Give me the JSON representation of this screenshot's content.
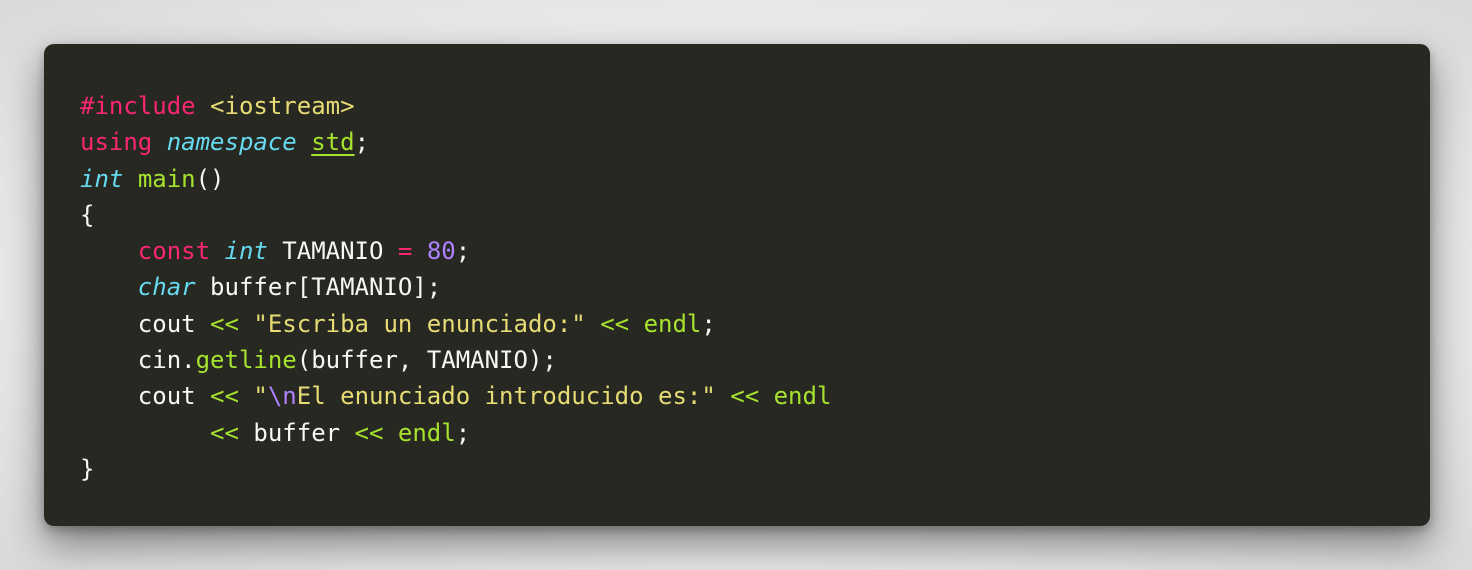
{
  "code": {
    "lines": [
      [
        {
          "t": "#include",
          "c": "kw"
        },
        {
          "t": " ",
          "c": "plain"
        },
        {
          "t": "<iostream>",
          "c": "str"
        }
      ],
      [
        {
          "t": "using",
          "c": "kw"
        },
        {
          "t": " ",
          "c": "plain"
        },
        {
          "t": "namespace",
          "c": "type"
        },
        {
          "t": " ",
          "c": "plain"
        },
        {
          "t": "std",
          "c": "ul"
        },
        {
          "t": ";",
          "c": "plain"
        }
      ],
      [
        {
          "t": "int",
          "c": "type"
        },
        {
          "t": " ",
          "c": "plain"
        },
        {
          "t": "main",
          "c": "fn"
        },
        {
          "t": "()",
          "c": "plain"
        }
      ],
      [
        {
          "t": "{",
          "c": "plain"
        }
      ],
      [
        {
          "t": "    ",
          "c": "plain"
        },
        {
          "t": "const",
          "c": "kw"
        },
        {
          "t": " ",
          "c": "plain"
        },
        {
          "t": "int",
          "c": "type"
        },
        {
          "t": " TAMANIO ",
          "c": "plain"
        },
        {
          "t": "=",
          "c": "op"
        },
        {
          "t": " ",
          "c": "plain"
        },
        {
          "t": "80",
          "c": "num"
        },
        {
          "t": ";",
          "c": "plain"
        }
      ],
      [
        {
          "t": "    ",
          "c": "plain"
        },
        {
          "t": "char",
          "c": "type"
        },
        {
          "t": " buffer[TAMANIO];",
          "c": "plain"
        }
      ],
      [
        {
          "t": "    cout ",
          "c": "plain"
        },
        {
          "t": "<<",
          "c": "stream"
        },
        {
          "t": " ",
          "c": "plain"
        },
        {
          "t": "\"Escriba un enunciado:\"",
          "c": "str"
        },
        {
          "t": " ",
          "c": "plain"
        },
        {
          "t": "<<",
          "c": "stream"
        },
        {
          "t": " ",
          "c": "plain"
        },
        {
          "t": "endl",
          "c": "fn"
        },
        {
          "t": ";",
          "c": "plain"
        }
      ],
      [
        {
          "t": "    cin.",
          "c": "plain"
        },
        {
          "t": "getline",
          "c": "fn"
        },
        {
          "t": "(buffer, TAMANIO);",
          "c": "plain"
        }
      ],
      [
        {
          "t": "    cout ",
          "c": "plain"
        },
        {
          "t": "<<",
          "c": "stream"
        },
        {
          "t": " ",
          "c": "plain"
        },
        {
          "t": "\"",
          "c": "str"
        },
        {
          "t": "\\n",
          "c": "esc"
        },
        {
          "t": "El enunciado introducido es:\"",
          "c": "str"
        },
        {
          "t": " ",
          "c": "plain"
        },
        {
          "t": "<<",
          "c": "stream"
        },
        {
          "t": " ",
          "c": "plain"
        },
        {
          "t": "endl",
          "c": "fn"
        }
      ],
      [
        {
          "t": "         ",
          "c": "plain"
        },
        {
          "t": "<<",
          "c": "stream"
        },
        {
          "t": " buffer ",
          "c": "plain"
        },
        {
          "t": "<<",
          "c": "stream"
        },
        {
          "t": " ",
          "c": "plain"
        },
        {
          "t": "endl",
          "c": "fn"
        },
        {
          "t": ";",
          "c": "plain"
        }
      ],
      [
        {
          "t": "}",
          "c": "plain"
        }
      ]
    ]
  },
  "colors": {
    "background": "#272822",
    "keyword": "#f92672",
    "type": "#66d9ef",
    "function": "#a6e22e",
    "string": "#e6db74",
    "number": "#ae81ff",
    "text": "#f8f8f2"
  }
}
